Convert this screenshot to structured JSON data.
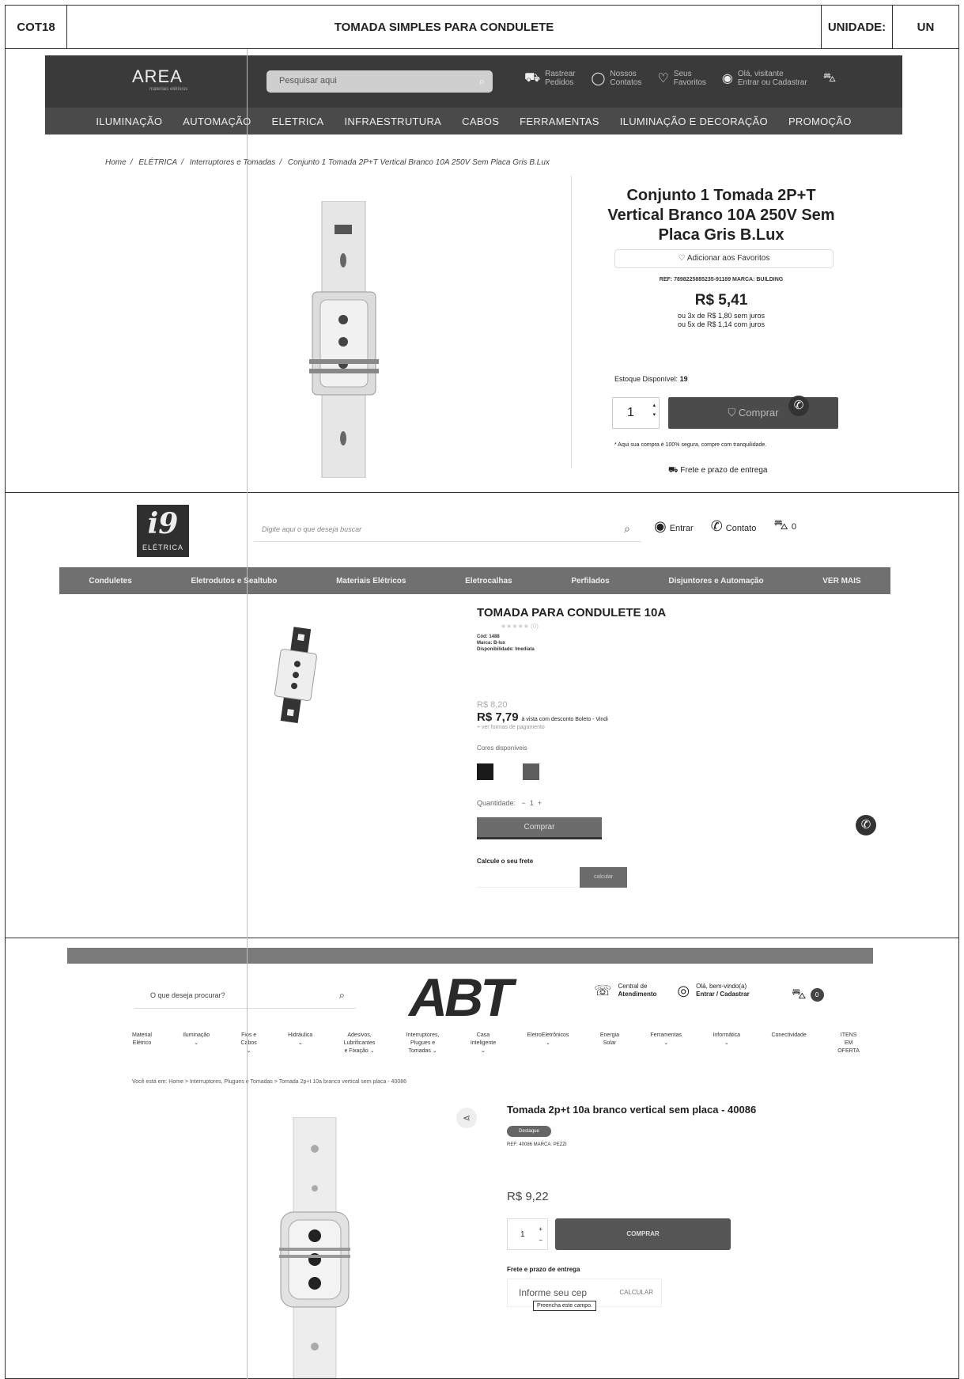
{
  "doc_header": {
    "code": "COT18",
    "title": "TOMADA SIMPLES PARA CONDULETE",
    "unit_label": "UNIDADE:",
    "unit_value": "UN"
  },
  "site1": {
    "logo": "AREA",
    "search_placeholder": "Pesquisar aqui",
    "header_links": [
      {
        "line1": "Rastrear",
        "line2": "Pedidos"
      },
      {
        "line1": "Nossos",
        "line2": "Contatos"
      },
      {
        "line1": "Seus",
        "line2": "Favoritos"
      },
      {
        "line1": "Olá, visitante",
        "line2": "Entrar ou Cadastrar"
      }
    ],
    "nav": [
      "ILUMINAÇÃO",
      "AUTOMAÇÃO",
      "ELETRICA",
      "INFRAESTRUTURA",
      "CABOS",
      "FERRAMENTAS",
      "ILUMINAÇÃO E DECORAÇÃO",
      "PROMOÇÃO"
    ],
    "breadcrumb": [
      "Home",
      "ELÉTRICA",
      "Interruptores e Tomadas",
      "Conjunto 1 Tomada 2P+T Vertical Branco 10A 250V Sem Placa Gris B.Lux"
    ],
    "product_title": "Conjunto 1 Tomada 2P+T Vertical Branco 10A 250V Sem Placa Gris B.Lux",
    "favorite_label": "Adicionar aos Favoritos",
    "ref": "REF: 7898225885235-91189   MARCA: BUILDING",
    "price": "R$ 5,41",
    "installment1": "ou 3x de R$ 1,80 sem juros",
    "installment2": "ou 5x de R$ 1,14 com juros",
    "stock_label": "Estoque Disponível:",
    "stock_value": "19",
    "quantity": "1",
    "buy_label": "Comprar",
    "secure_note": "* Aqui sua compra é 100% segura, compre com tranquilidade.",
    "shipping_label": "Frete e prazo de entrega"
  },
  "site2": {
    "logo": "i9",
    "logo_sub": "ELÉTRICA",
    "search_placeholder": "Digite aqui o que deseja buscar",
    "enter_label": "Entrar",
    "contact_label": "Contato",
    "cart_count": "0",
    "nav": [
      "Conduletes",
      "Eletrodutos e Sealtubo",
      "Materiais Elétricos",
      "Eletrocalhas",
      "Perfilados",
      "Disjuntores e Automação",
      "VER MAIS"
    ],
    "product_title": "TOMADA PARA CONDULETE 10A",
    "rating": "★★★★★ (0)",
    "code": "Cód: 1488",
    "brand": "Marca: B-lux",
    "availability": "Disponibilidade: Imediata",
    "old_price": "R$ 8,20",
    "price": "R$ 7,79",
    "price_note": "à vista com desconto Boleto - Vindi",
    "payment_link": "+ ver formas de pagamento",
    "colors_label": "Cores disponíveis",
    "colors": [
      "#1a1a1a",
      "#5e5e5e"
    ],
    "quantity_label": "Quantidade:",
    "quantity": "1",
    "buy_label": "Comprar",
    "shipping_label": "Calcule o seu frete",
    "shipping_button": "calcular"
  },
  "site3": {
    "search_placeholder": "O que deseja procurar?",
    "logo": "ABT",
    "service_line1": "Central de",
    "service_line2": "Atendimento",
    "account_line1": "Olá, bem-vindo(a)",
    "account_line2": "Entrar / Cadastrar",
    "cart_count": "0",
    "nav": [
      {
        "l1": "Material",
        "l2": "Elétrico",
        "l3": ""
      },
      {
        "l1": "Iluminação",
        "l2": "⌄",
        "l3": ""
      },
      {
        "l1": "Fios e",
        "l2": "Cabos",
        "l3": "⌄"
      },
      {
        "l1": "Hidráulica",
        "l2": "⌄",
        "l3": ""
      },
      {
        "l1": "Adesivos,",
        "l2": "Lubrificantes",
        "l3": "e Fixação ⌄"
      },
      {
        "l1": "Interruptores,",
        "l2": "Plugues e",
        "l3": "Tomadas ⌄"
      },
      {
        "l1": "Casa",
        "l2": "Inteligente",
        "l3": "⌄"
      },
      {
        "l1": "EletroEletrônicos",
        "l2": "⌄",
        "l3": ""
      },
      {
        "l1": "Energia",
        "l2": "Solar",
        "l3": ""
      },
      {
        "l1": "Ferramentas",
        "l2": "⌄",
        "l3": ""
      },
      {
        "l1": "Informática",
        "l2": "⌄",
        "l3": ""
      },
      {
        "l1": "Conectividade",
        "l2": "",
        "l3": ""
      },
      {
        "l1": "ITENS",
        "l2": "EM",
        "l3": "OFERTA"
      }
    ],
    "breadcrumb": "Você está em: Home  >  Interruptores, Plugues e Tomadas  >  Tomada 2p+t 10a branco vertical sem placa - 40086",
    "product_title": "Tomada 2p+t 10a branco vertical sem placa - 40086",
    "badge": "Destaque",
    "ref": "REF: 40086   MARCA: PEZZI",
    "price": "R$ 9,22",
    "quantity": "1",
    "buy_label": "COMPRAR",
    "shipping_label": "Frete e prazo de entrega",
    "cep_placeholder": "Informe seu cep",
    "cep_button": "CALCULAR",
    "tooltip": "Preencha este campo."
  }
}
